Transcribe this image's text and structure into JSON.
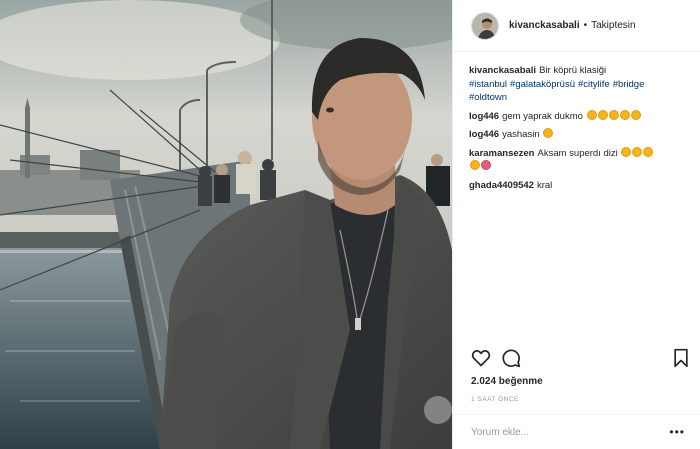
{
  "post": {
    "username": "kivanckasabali",
    "follow_status": "Takiptesin",
    "separator": "•",
    "caption": {
      "user": "kivanckasabali",
      "text": "Bir köprü klasiği",
      "hashtags": [
        "#istanbul",
        "#galataköprüsü",
        "#citylife",
        "#bridge",
        "#oldtown"
      ]
    },
    "comments": [
      {
        "user": "log446",
        "text": "gem yaprak dukmo",
        "emoji_count": 5
      },
      {
        "user": "log446",
        "text": "yashasin",
        "emoji_count": 1
      },
      {
        "user": "karamansezen",
        "text": "Aksam superdı dizi",
        "emoji_count": 5
      },
      {
        "user": "ghada4409542",
        "text": "kral",
        "emoji_count": 0
      }
    ],
    "likes": "2.024 beğenme",
    "time_ago": "1 SAAT ÖNCE",
    "add_comment_placeholder": "Yorum ekle...",
    "more_options": "•••"
  },
  "icons": {
    "heart": "heart-icon",
    "comment": "comment-bubble-icon",
    "save": "bookmark-icon",
    "emoji": "emoji-icon"
  },
  "colors": {
    "text": "#262626",
    "hashtag": "#003569",
    "muted": "#999999",
    "border": "#efefef"
  }
}
